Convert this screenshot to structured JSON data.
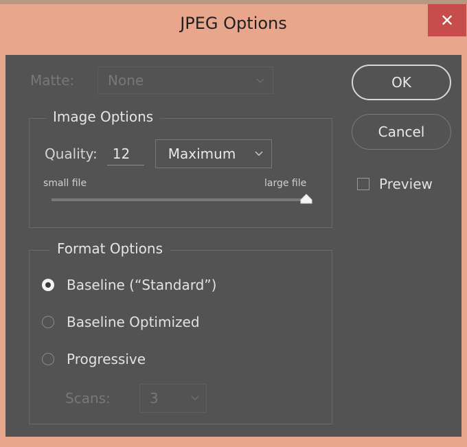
{
  "window": {
    "title": "JPEG Options",
    "close_glyph": "✕"
  },
  "matte": {
    "label": "Matte:",
    "value": "None"
  },
  "image_options": {
    "title": "Image Options",
    "quality_label": "Quality:",
    "quality_value": "12",
    "quality_preset": "Maximum",
    "small_label": "small file",
    "large_label": "large file",
    "slider_position": 1.0
  },
  "format_options": {
    "title": "Format Options",
    "radios": [
      {
        "label": "Baseline (“Standard”)",
        "checked": true
      },
      {
        "label": "Baseline Optimized",
        "checked": false
      },
      {
        "label": "Progressive",
        "checked": false
      }
    ],
    "scans_label": "Scans:",
    "scans_value": "3"
  },
  "buttons": {
    "ok": "OK",
    "cancel": "Cancel"
  },
  "preview": {
    "label": "Preview",
    "checked": false
  },
  "icons": {
    "dropdown": "chevron-down-icon",
    "close": "close-icon"
  },
  "colors": {
    "title_bar": "#e8a68d",
    "close_button": "#c74c4c",
    "panel": "#535353"
  }
}
